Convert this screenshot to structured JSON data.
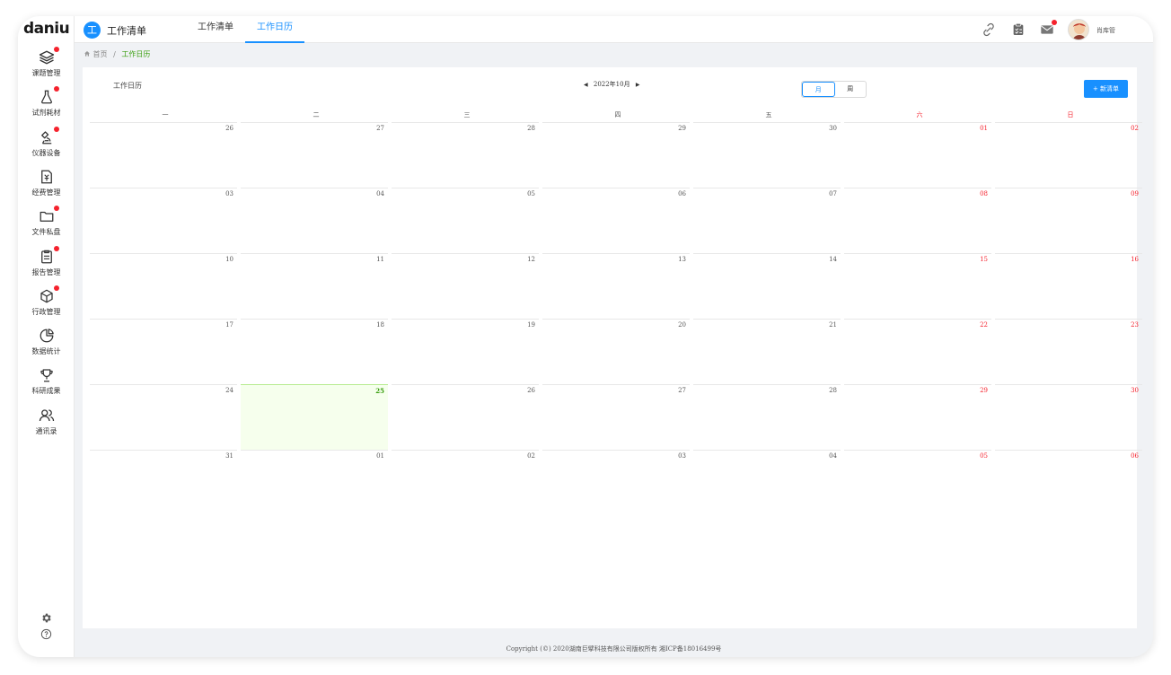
{
  "brand": {
    "logo_text": "daniu"
  },
  "sidebar": {
    "items": [
      {
        "label": "课题管理",
        "icon": "layers-icon",
        "dot": true
      },
      {
        "label": "试剂耗材",
        "icon": "flask-icon",
        "dot": true
      },
      {
        "label": "仪器设备",
        "icon": "microscope-icon",
        "dot": true
      },
      {
        "label": "经费管理",
        "icon": "finance-doc-icon",
        "dot": false
      },
      {
        "label": "文件私盘",
        "icon": "folder-icon",
        "dot": true
      },
      {
        "label": "报告管理",
        "icon": "clipboard-icon",
        "dot": true
      },
      {
        "label": "行政管理",
        "icon": "cube-icon",
        "dot": true
      },
      {
        "label": "数据统计",
        "icon": "pie-chart-icon",
        "dot": false
      },
      {
        "label": "科研成果",
        "icon": "trophy-icon",
        "dot": false
      },
      {
        "label": "通讯录",
        "icon": "contacts-icon",
        "dot": false
      }
    ]
  },
  "header": {
    "app_badge": "工",
    "app_title": "工作清单",
    "tabs": [
      {
        "label": "工作清单",
        "active": false
      },
      {
        "label": "工作日历",
        "active": true
      }
    ],
    "username": "肖库管"
  },
  "breadcrumb": {
    "home": "首页",
    "separator": "/",
    "current": "工作日历"
  },
  "calendar": {
    "title": "工作日历",
    "month_label": "2022年10月",
    "view_options": [
      {
        "label": "月",
        "active": true
      },
      {
        "label": "周",
        "active": false
      }
    ],
    "new_button": "+ 新清单",
    "weekdays": [
      "一",
      "二",
      "三",
      "四",
      "五",
      "六",
      "日"
    ],
    "weeks": [
      [
        "26",
        "27",
        "28",
        "29",
        "30",
        "01",
        "02"
      ],
      [
        "03",
        "04",
        "05",
        "06",
        "07",
        "08",
        "09"
      ],
      [
        "10",
        "11",
        "12",
        "13",
        "14",
        "15",
        "16"
      ],
      [
        "17",
        "18",
        "19",
        "20",
        "21",
        "22",
        "23"
      ],
      [
        "24",
        "25",
        "26",
        "27",
        "28",
        "29",
        "30"
      ],
      [
        "31",
        "01",
        "02",
        "03",
        "04",
        "05",
        "06"
      ]
    ],
    "today": {
      "week": 4,
      "day": 1
    }
  },
  "footer": {
    "text": "Copyright (©) 2020湖南巨擘科技有限公司版权所有 湘ICP备18016499号"
  },
  "colors": {
    "accent": "#1890ff",
    "weekend": "#f5222d",
    "today_bg": "#f6ffed",
    "today_text": "#389e0d"
  }
}
